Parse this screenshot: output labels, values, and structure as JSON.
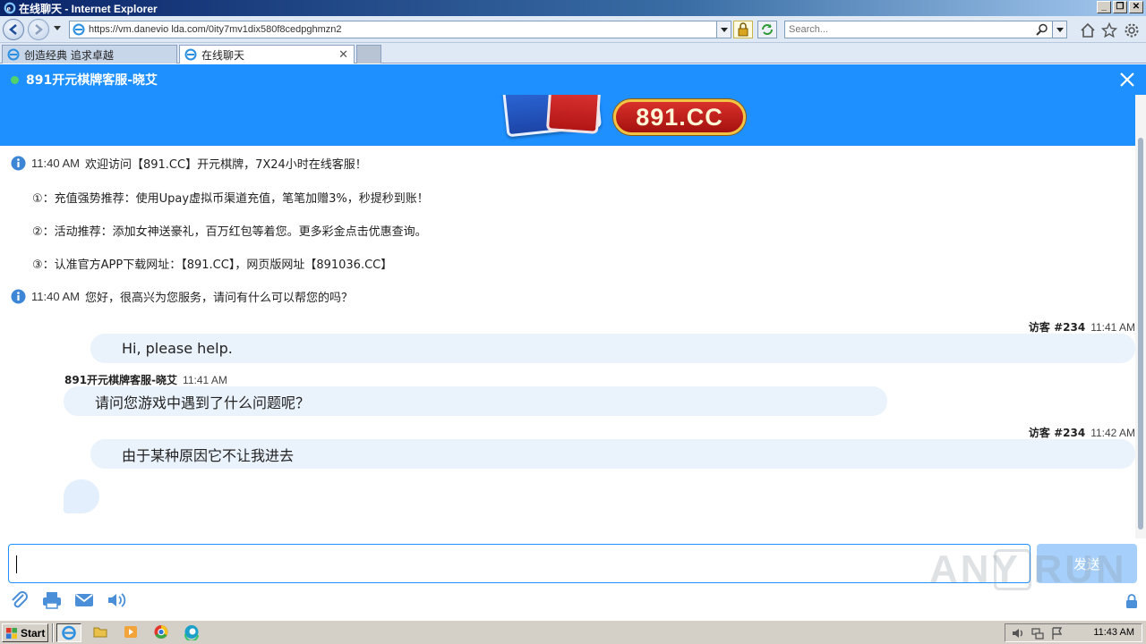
{
  "window": {
    "title": "在线聊天 - Internet Explorer",
    "controls": [
      "_",
      "❐",
      "✕"
    ]
  },
  "browser": {
    "address": "https://vm.danevio lda.com/0ity7mv1dix580f8cedpghmzn2",
    "search_placeholder": "Search...",
    "tabs": [
      {
        "label": "创造经典 追求卓越",
        "active": false
      },
      {
        "label": "在线聊天",
        "active": true
      }
    ]
  },
  "chat": {
    "header_title": "891开元棋牌客服-晓艾",
    "banner_logo_text": "891.CC",
    "system_messages": [
      {
        "time": "11:40 AM",
        "text": "欢迎访问【891.CC】开元棋牌，7X24小时在线客服！"
      },
      {
        "time": "11:40 AM",
        "text": "您好，很高兴为您服务，请问有什么可以帮您的吗？"
      }
    ],
    "notices": [
      "①：充值强势推荐：使用Upay虚拟币渠道充值，笔笔加赠3%，秒提秒到账！",
      "②：活动推荐：添加女神送豪礼，百万红包等着您。更多彩金点击优惠查询。",
      "③：认准官方APP下载网址：【891.CC】，网页版网址【891036.CC】"
    ],
    "messages": [
      {
        "from": "visitor",
        "name": "访客 #234",
        "time": "11:41 AM",
        "text": "Hi, please help."
      },
      {
        "from": "agent",
        "name": "891开元棋牌客服-晓艾",
        "time": "11:41 AM",
        "text": "请问您游戏中遇到了什么问题呢？"
      },
      {
        "from": "visitor",
        "name": "访客 #234",
        "time": "11:42 AM",
        "text": "由于某种原因它不让我进去"
      }
    ],
    "input_value": "",
    "send_label": "发送",
    "watermark": "ANY RUN"
  },
  "taskbar": {
    "start_label": "Start",
    "clock": "11:43 AM"
  },
  "colors": {
    "chat_blue": "#1e90ff",
    "bubble_bg": "#eaf2fc",
    "online": "#52d26b"
  },
  "icons": {
    "info": "info-icon",
    "attach": "paperclip-icon",
    "print": "printer-icon",
    "email": "envelope-icon",
    "sound": "speaker-icon"
  }
}
